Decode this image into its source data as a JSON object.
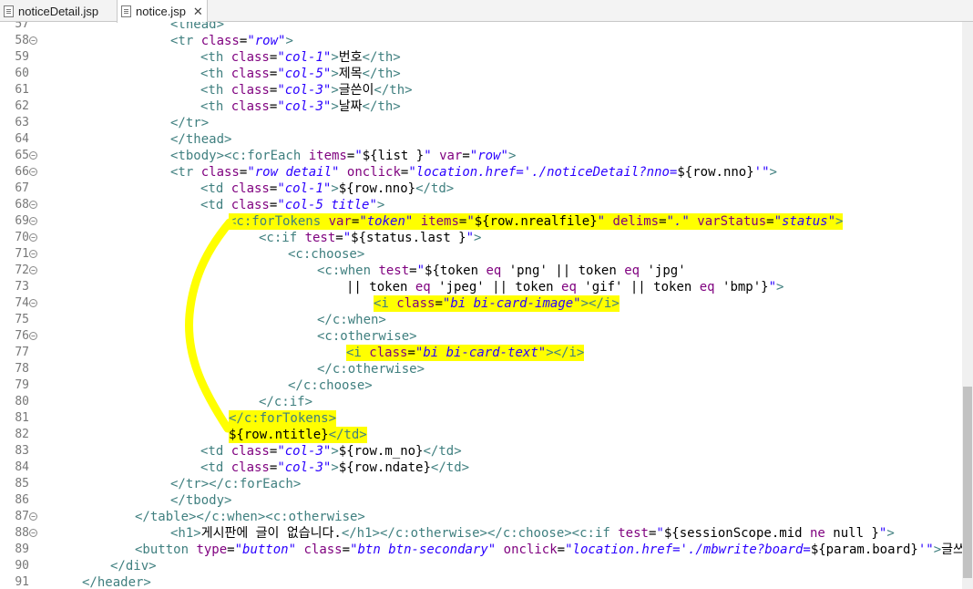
{
  "tabs": [
    {
      "label": "noticeDetail.jsp",
      "active": false
    },
    {
      "label": "notice.jsp",
      "active": true,
      "close": "✕"
    }
  ],
  "colors": {
    "tag": "#3f7f7f",
    "attr": "#7f007f",
    "value": "#2a00ff",
    "highlight": "#ffff00",
    "annotation": "#ffff00"
  },
  "lines": [
    {
      "n": "57",
      "fold": false,
      "tokens": [
        [
          "t",
          "<thead>"
        ]
      ]
    },
    {
      "n": "58",
      "fold": true,
      "tokens": [
        [
          "t",
          "<tr "
        ],
        [
          "a",
          "class"
        ],
        [
          "x",
          "="
        ],
        [
          "v",
          "\"row\""
        ],
        [
          "t",
          ">"
        ]
      ]
    },
    {
      "n": "59",
      "fold": false,
      "tokens": [
        [
          "t",
          "<th "
        ],
        [
          "a",
          "class"
        ],
        [
          "x",
          "="
        ],
        [
          "v",
          "\"col-1\""
        ],
        [
          "t",
          ">"
        ],
        [
          "x",
          "번호"
        ],
        [
          "t",
          "</th>"
        ]
      ]
    },
    {
      "n": "60",
      "fold": false,
      "tokens": [
        [
          "t",
          "<th "
        ],
        [
          "a",
          "class"
        ],
        [
          "x",
          "="
        ],
        [
          "v",
          "\"col-5\""
        ],
        [
          "t",
          ">"
        ],
        [
          "x",
          "제목"
        ],
        [
          "t",
          "</th>"
        ]
      ]
    },
    {
      "n": "61",
      "fold": false,
      "tokens": [
        [
          "t",
          "<th "
        ],
        [
          "a",
          "class"
        ],
        [
          "x",
          "="
        ],
        [
          "v",
          "\"col-3\""
        ],
        [
          "t",
          ">"
        ],
        [
          "x",
          "글쓴이"
        ],
        [
          "t",
          "</th>"
        ]
      ]
    },
    {
      "n": "62",
      "fold": false,
      "tokens": [
        [
          "t",
          "<th "
        ],
        [
          "a",
          "class"
        ],
        [
          "x",
          "="
        ],
        [
          "v",
          "\"col-3\""
        ],
        [
          "t",
          ">"
        ],
        [
          "x",
          "날짜"
        ],
        [
          "t",
          "</th>"
        ]
      ]
    },
    {
      "n": "63",
      "fold": false,
      "tokens": [
        [
          "t",
          "</tr>"
        ]
      ]
    },
    {
      "n": "64",
      "fold": false,
      "tokens": [
        [
          "t",
          "</thead>"
        ]
      ]
    },
    {
      "n": "65",
      "fold": true,
      "tokens": [
        [
          "t",
          "<tbody><c:forEach "
        ],
        [
          "a",
          "items"
        ],
        [
          "x",
          "="
        ],
        [
          "v",
          "\""
        ],
        [
          "x",
          "${list }"
        ],
        [
          "v",
          "\""
        ],
        [
          "x",
          " "
        ],
        [
          "a",
          "var"
        ],
        [
          "x",
          "="
        ],
        [
          "v",
          "\"row\""
        ],
        [
          "t",
          ">"
        ]
      ]
    },
    {
      "n": "66",
      "fold": true,
      "tokens": [
        [
          "t",
          "<tr "
        ],
        [
          "a",
          "class"
        ],
        [
          "x",
          "="
        ],
        [
          "v",
          "\"row detail\""
        ],
        [
          "x",
          " "
        ],
        [
          "a",
          "onclick"
        ],
        [
          "x",
          "="
        ],
        [
          "v",
          "\"location.href='./noticeDetail?nno="
        ],
        [
          "x",
          "${row.nno}"
        ],
        [
          "v",
          "'\""
        ],
        [
          "t",
          ">"
        ]
      ]
    },
    {
      "n": "67",
      "fold": false,
      "tokens": [
        [
          "t",
          "<td "
        ],
        [
          "a",
          "class"
        ],
        [
          "x",
          "="
        ],
        [
          "v",
          "\"col-1\""
        ],
        [
          "t",
          ">"
        ],
        [
          "x",
          "${row.nno}"
        ],
        [
          "t",
          "</td>"
        ]
      ]
    },
    {
      "n": "68",
      "fold": true,
      "tokens": [
        [
          "t",
          "<td "
        ],
        [
          "a",
          "class"
        ],
        [
          "x",
          "="
        ],
        [
          "v",
          "\"col-5 title\""
        ],
        [
          "t",
          ">"
        ]
      ]
    },
    {
      "n": "69",
      "fold": true,
      "hl": true,
      "tokens": [
        [
          "t",
          "<c:forTokens "
        ],
        [
          "a",
          "var"
        ],
        [
          "x",
          "="
        ],
        [
          "v",
          "\"token\""
        ],
        [
          "x",
          " "
        ],
        [
          "a",
          "items"
        ],
        [
          "x",
          "="
        ],
        [
          "v",
          "\""
        ],
        [
          "x",
          "${row.nrealfile}"
        ],
        [
          "v",
          "\""
        ],
        [
          "x",
          " "
        ],
        [
          "a",
          "delims"
        ],
        [
          "x",
          "="
        ],
        [
          "v",
          "\".\""
        ],
        [
          "x",
          " "
        ],
        [
          "a",
          "varStatus"
        ],
        [
          "x",
          "="
        ],
        [
          "v",
          "\"status\""
        ],
        [
          "t",
          ">"
        ]
      ]
    },
    {
      "n": "70",
      "fold": true,
      "tokens": [
        [
          "t",
          "<c:if "
        ],
        [
          "a",
          "test"
        ],
        [
          "x",
          "="
        ],
        [
          "v",
          "\""
        ],
        [
          "x",
          "${status.last }"
        ],
        [
          "v",
          "\""
        ],
        [
          "t",
          ">"
        ]
      ]
    },
    {
      "n": "71",
      "fold": true,
      "tokens": [
        [
          "t",
          "<c:choose>"
        ]
      ]
    },
    {
      "n": "72",
      "fold": true,
      "tokens": [
        [
          "t",
          "<c:when "
        ],
        [
          "a",
          "test"
        ],
        [
          "x",
          "="
        ],
        [
          "v",
          "\""
        ],
        [
          "x",
          "${token "
        ],
        [
          "a",
          "eq"
        ],
        [
          "x",
          " 'png' || token "
        ],
        [
          "a",
          "eq"
        ],
        [
          "x",
          " 'jpg'"
        ]
      ]
    },
    {
      "n": "73",
      "fold": false,
      "tokens": [
        [
          "x",
          "|| token "
        ],
        [
          "a",
          "eq"
        ],
        [
          "x",
          " 'jpeg' || token "
        ],
        [
          "a",
          "eq"
        ],
        [
          "x",
          " 'gif' || token "
        ],
        [
          "a",
          "eq"
        ],
        [
          "x",
          " 'bmp'}"
        ],
        [
          "v",
          "\""
        ],
        [
          "t",
          ">"
        ]
      ]
    },
    {
      "n": "74",
      "fold": true,
      "hl": true,
      "tokens": [
        [
          "t",
          "<i "
        ],
        [
          "a",
          "class"
        ],
        [
          "x",
          "="
        ],
        [
          "v",
          "\"bi bi-card-image\""
        ],
        [
          "t",
          "></i>"
        ]
      ]
    },
    {
      "n": "75",
      "fold": false,
      "tokens": [
        [
          "t",
          "</c:when>"
        ]
      ]
    },
    {
      "n": "76",
      "fold": true,
      "tokens": [
        [
          "t",
          "<c:otherwise>"
        ]
      ]
    },
    {
      "n": "77",
      "fold": false,
      "hl": true,
      "tokens": [
        [
          "t",
          "<i "
        ],
        [
          "a",
          "class"
        ],
        [
          "x",
          "="
        ],
        [
          "v",
          "\"bi bi-card-text\""
        ],
        [
          "t",
          "></i>"
        ]
      ]
    },
    {
      "n": "78",
      "fold": false,
      "tokens": [
        [
          "t",
          "</c:otherwise>"
        ]
      ]
    },
    {
      "n": "79",
      "fold": false,
      "tokens": [
        [
          "t",
          "</c:choose>"
        ]
      ]
    },
    {
      "n": "80",
      "fold": false,
      "tokens": [
        [
          "t",
          "</c:if>"
        ]
      ]
    },
    {
      "n": "81",
      "fold": false,
      "hl": true,
      "tokens": [
        [
          "t",
          "</c:forTokens>"
        ]
      ]
    },
    {
      "n": "82",
      "fold": false,
      "hl": true,
      "tokens": [
        [
          "x",
          "${row.ntitle}"
        ],
        [
          "t",
          "</td>"
        ]
      ]
    },
    {
      "n": "83",
      "fold": false,
      "tokens": [
        [
          "t",
          "<td "
        ],
        [
          "a",
          "class"
        ],
        [
          "x",
          "="
        ],
        [
          "v",
          "\"col-3\""
        ],
        [
          "t",
          ">"
        ],
        [
          "x",
          "${row.m_no}"
        ],
        [
          "t",
          "</td>"
        ]
      ]
    },
    {
      "n": "84",
      "fold": false,
      "tokens": [
        [
          "t",
          "<td "
        ],
        [
          "a",
          "class"
        ],
        [
          "x",
          "="
        ],
        [
          "v",
          "\"col-3\""
        ],
        [
          "t",
          ">"
        ],
        [
          "x",
          "${row.ndate}"
        ],
        [
          "t",
          "</td>"
        ]
      ]
    },
    {
      "n": "85",
      "fold": false,
      "tokens": [
        [
          "t",
          "</tr></c:forEach>"
        ]
      ]
    },
    {
      "n": "86",
      "fold": false,
      "tokens": [
        [
          "t",
          "</tbody>"
        ]
      ]
    },
    {
      "n": "87",
      "fold": true,
      "tokens": [
        [
          "t",
          "</table></c:when><c:otherwise>"
        ]
      ]
    },
    {
      "n": "88",
      "fold": true,
      "tokens": [
        [
          "t",
          "<h1>"
        ],
        [
          "x",
          "게시판에 글이 없습니다."
        ],
        [
          "t",
          "</h1></c:otherwise></c:choose><c:if "
        ],
        [
          "a",
          "test"
        ],
        [
          "x",
          "="
        ],
        [
          "v",
          "\""
        ],
        [
          "x",
          "${sessionScope.mid "
        ],
        [
          "a",
          "ne"
        ],
        [
          "x",
          " null }"
        ],
        [
          "v",
          "\""
        ],
        [
          "t",
          ">"
        ]
      ]
    },
    {
      "n": "89",
      "fold": false,
      "tokens": [
        [
          "t",
          "<button "
        ],
        [
          "a",
          "type"
        ],
        [
          "x",
          "="
        ],
        [
          "v",
          "\"button\""
        ],
        [
          "x",
          " "
        ],
        [
          "a",
          "class"
        ],
        [
          "x",
          "="
        ],
        [
          "v",
          "\"btn btn-secondary\""
        ],
        [
          "x",
          " "
        ],
        [
          "a",
          "onclick"
        ],
        [
          "x",
          "="
        ],
        [
          "v",
          "\"location.href='./mbwrite?board="
        ],
        [
          "x",
          "${param.board}"
        ],
        [
          "v",
          "'\""
        ],
        [
          "t",
          ">"
        ],
        [
          "x",
          "글쓰기"
        ],
        [
          "t",
          "</b"
        ]
      ]
    },
    {
      "n": "90",
      "fold": false,
      "tokens": [
        [
          "t",
          "</div>"
        ]
      ]
    },
    {
      "n": "91",
      "fold": false,
      "tokens": [
        [
          "t",
          "</header>"
        ]
      ]
    }
  ]
}
